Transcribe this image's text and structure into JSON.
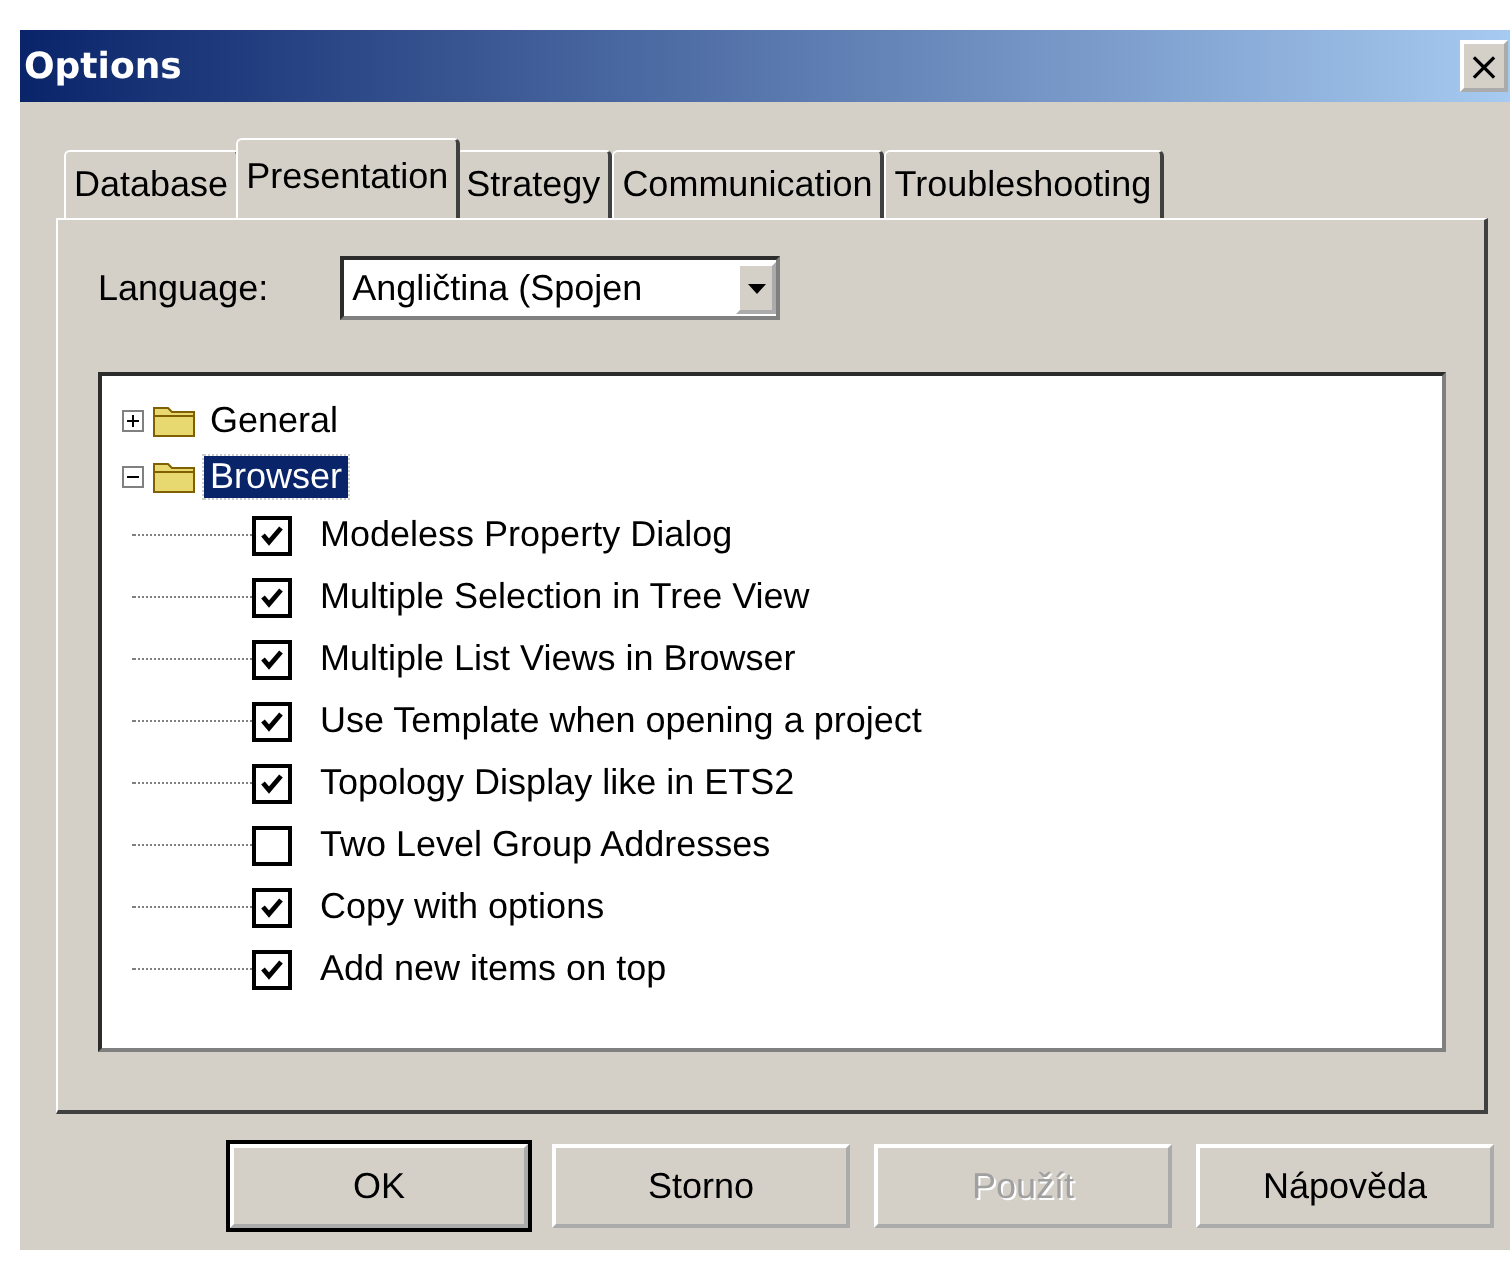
{
  "window": {
    "title": "Options",
    "close": "×"
  },
  "tabs": [
    {
      "label": "Database",
      "selected": false
    },
    {
      "label": "Presentation",
      "selected": true
    },
    {
      "label": "Strategy",
      "selected": false
    },
    {
      "label": "Communication",
      "selected": false
    },
    {
      "label": "Troubleshooting",
      "selected": false
    }
  ],
  "language": {
    "label": "Language:",
    "value": "Angličtina (Spojen"
  },
  "tree": [
    {
      "label": "General",
      "expanded": false,
      "selected": false
    },
    {
      "label": "Browser",
      "expanded": true,
      "selected": true,
      "children": [
        {
          "label": "Modeless Property Dialog",
          "checked": true
        },
        {
          "label": "Multiple Selection in Tree View",
          "checked": true
        },
        {
          "label": "Multiple List Views in Browser",
          "checked": true
        },
        {
          "label": "Use Template when opening a project",
          "checked": true
        },
        {
          "label": "Topology Display like in ETS2",
          "checked": true
        },
        {
          "label": "Two Level Group Addresses",
          "checked": false
        },
        {
          "label": "Copy with options",
          "checked": true
        },
        {
          "label": "Add new items on top",
          "checked": true
        }
      ]
    }
  ],
  "buttons": [
    {
      "label": "OK",
      "default": true,
      "disabled": false
    },
    {
      "label": "Storno",
      "default": false,
      "disabled": false
    },
    {
      "label": "Použít",
      "default": false,
      "disabled": true
    },
    {
      "label": "Nápověda",
      "default": false,
      "disabled": false
    }
  ]
}
